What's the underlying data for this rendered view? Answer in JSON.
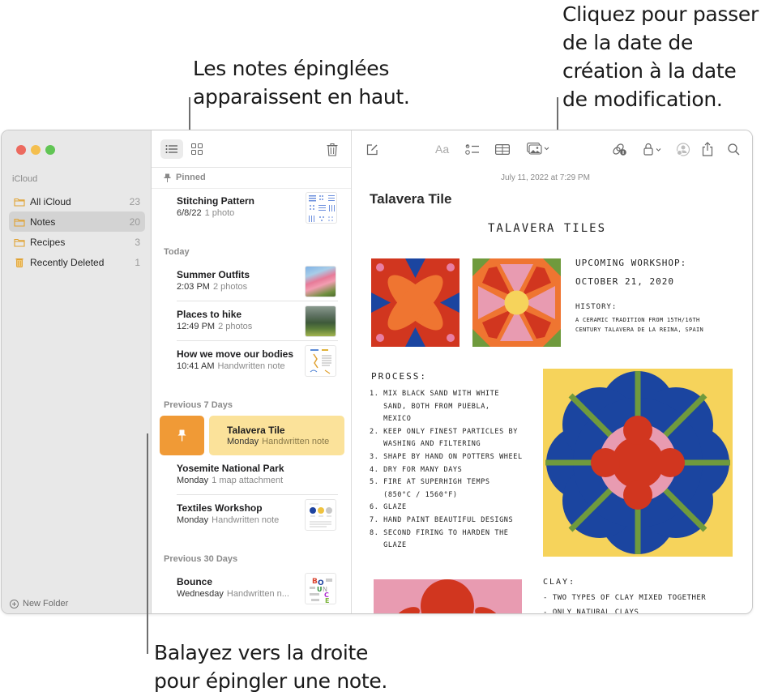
{
  "callouts": {
    "pinned_top": [
      "Les notes épinglées",
      "apparaissent en haut."
    ],
    "date_toggle": [
      "Cliquez pour passer",
      "de la date de",
      "création à la date",
      "de modification."
    ],
    "swipe_pin": [
      "Balayez vers la droite",
      "pour épingler une note."
    ]
  },
  "sidebar": {
    "section": "iCloud",
    "folders": [
      {
        "label": "All iCloud",
        "count": "23",
        "icon": "folder-icon",
        "active": false
      },
      {
        "label": "Notes",
        "count": "20",
        "icon": "folder-icon",
        "active": true
      },
      {
        "label": "Recipes",
        "count": "3",
        "icon": "folder-icon",
        "active": false
      },
      {
        "label": "Recently Deleted",
        "count": "1",
        "icon": "trash-icon",
        "active": false
      }
    ],
    "new_folder": "New Folder"
  },
  "note_list": {
    "sections": [
      {
        "header": "Pinned",
        "notes": [
          {
            "title": "Stitching Pattern",
            "date": "6/8/22",
            "sub": "1 photo",
            "thumb": "pattern"
          }
        ]
      },
      {
        "header": "Today",
        "notes": [
          {
            "title": "Summer Outfits",
            "date": "2:03 PM",
            "sub": "2 photos",
            "thumb": "photo-pink"
          },
          {
            "title": "Places to hike",
            "date": "12:49 PM",
            "sub": "2 photos",
            "thumb": "photo-forest"
          },
          {
            "title": "How we move our bodies",
            "date": "10:41 AM",
            "sub": "Handwritten note",
            "thumb": "sketch"
          }
        ]
      },
      {
        "header": "Previous 7 Days",
        "notes": [
          {
            "title": "Talavera Tile",
            "date": "Monday",
            "sub": "Handwritten note",
            "selected": true
          },
          {
            "title": "Yosemite National Park",
            "date": "Monday",
            "sub": "1 map attachment"
          },
          {
            "title": "Textiles Workshop",
            "date": "Monday",
            "sub": "Handwritten note",
            "thumb": "textiles"
          }
        ]
      },
      {
        "header": "Previous 30 Days",
        "notes": [
          {
            "title": "Bounce",
            "date": "Wednesday",
            "sub": "Handwritten n...",
            "thumb": "bounce"
          }
        ]
      }
    ]
  },
  "editor": {
    "date": "July 11, 2022 at 7:29 PM",
    "title": "Talavera Tile",
    "handwritten": {
      "heading": "TALAVERA TILES",
      "workshop_label": "UPCOMING WORKSHOP:",
      "workshop_date": "OCTOBER 21, 2020",
      "history_label": "HISTORY:",
      "history_lines": [
        "A CERAMIC TRADITION FROM 15TH/16TH",
        "CENTURY TALAVERA DE LA REINA, SPAIN"
      ],
      "process_label": "PROCESS:",
      "process_lines": [
        "1. MIX BLACK SAND WITH WHITE",
        "   SAND, BOTH FROM PUEBLA,",
        "   MEXICO",
        "2. KEEP ONLY FINEST PARTICLES BY",
        "   WASHING AND FILTERING",
        "3. SHAPE BY HAND ON POTTERS WHEEL",
        "4. DRY FOR MANY DAYS",
        "5. FIRE AT SUPERHIGH TEMPS",
        "   (850°C / 1560°F)",
        "6. GLAZE",
        "7. HAND PAINT BEAUTIFUL DESIGNS",
        "8. SECOND FIRING TO HARDEN THE",
        "   GLAZE"
      ],
      "clay_label": "CLAY:",
      "clay_lines": [
        "- TWO TYPES OF CLAY MIXED TOGETHER",
        "- ONLY NATURAL CLAYS"
      ]
    },
    "toolbar": {
      "format_label": "Aa"
    }
  },
  "colors": {
    "accent": "#e7a633",
    "pin_action": "#f09a36",
    "selected_note": "#fbe29a",
    "tile_red": "#d1361f",
    "tile_orange": "#ef7531",
    "tile_blue": "#1b45a0",
    "tile_pink": "#e89bb1",
    "tile_yellow": "#f6d35b",
    "tile_green": "#6f9a3d"
  }
}
